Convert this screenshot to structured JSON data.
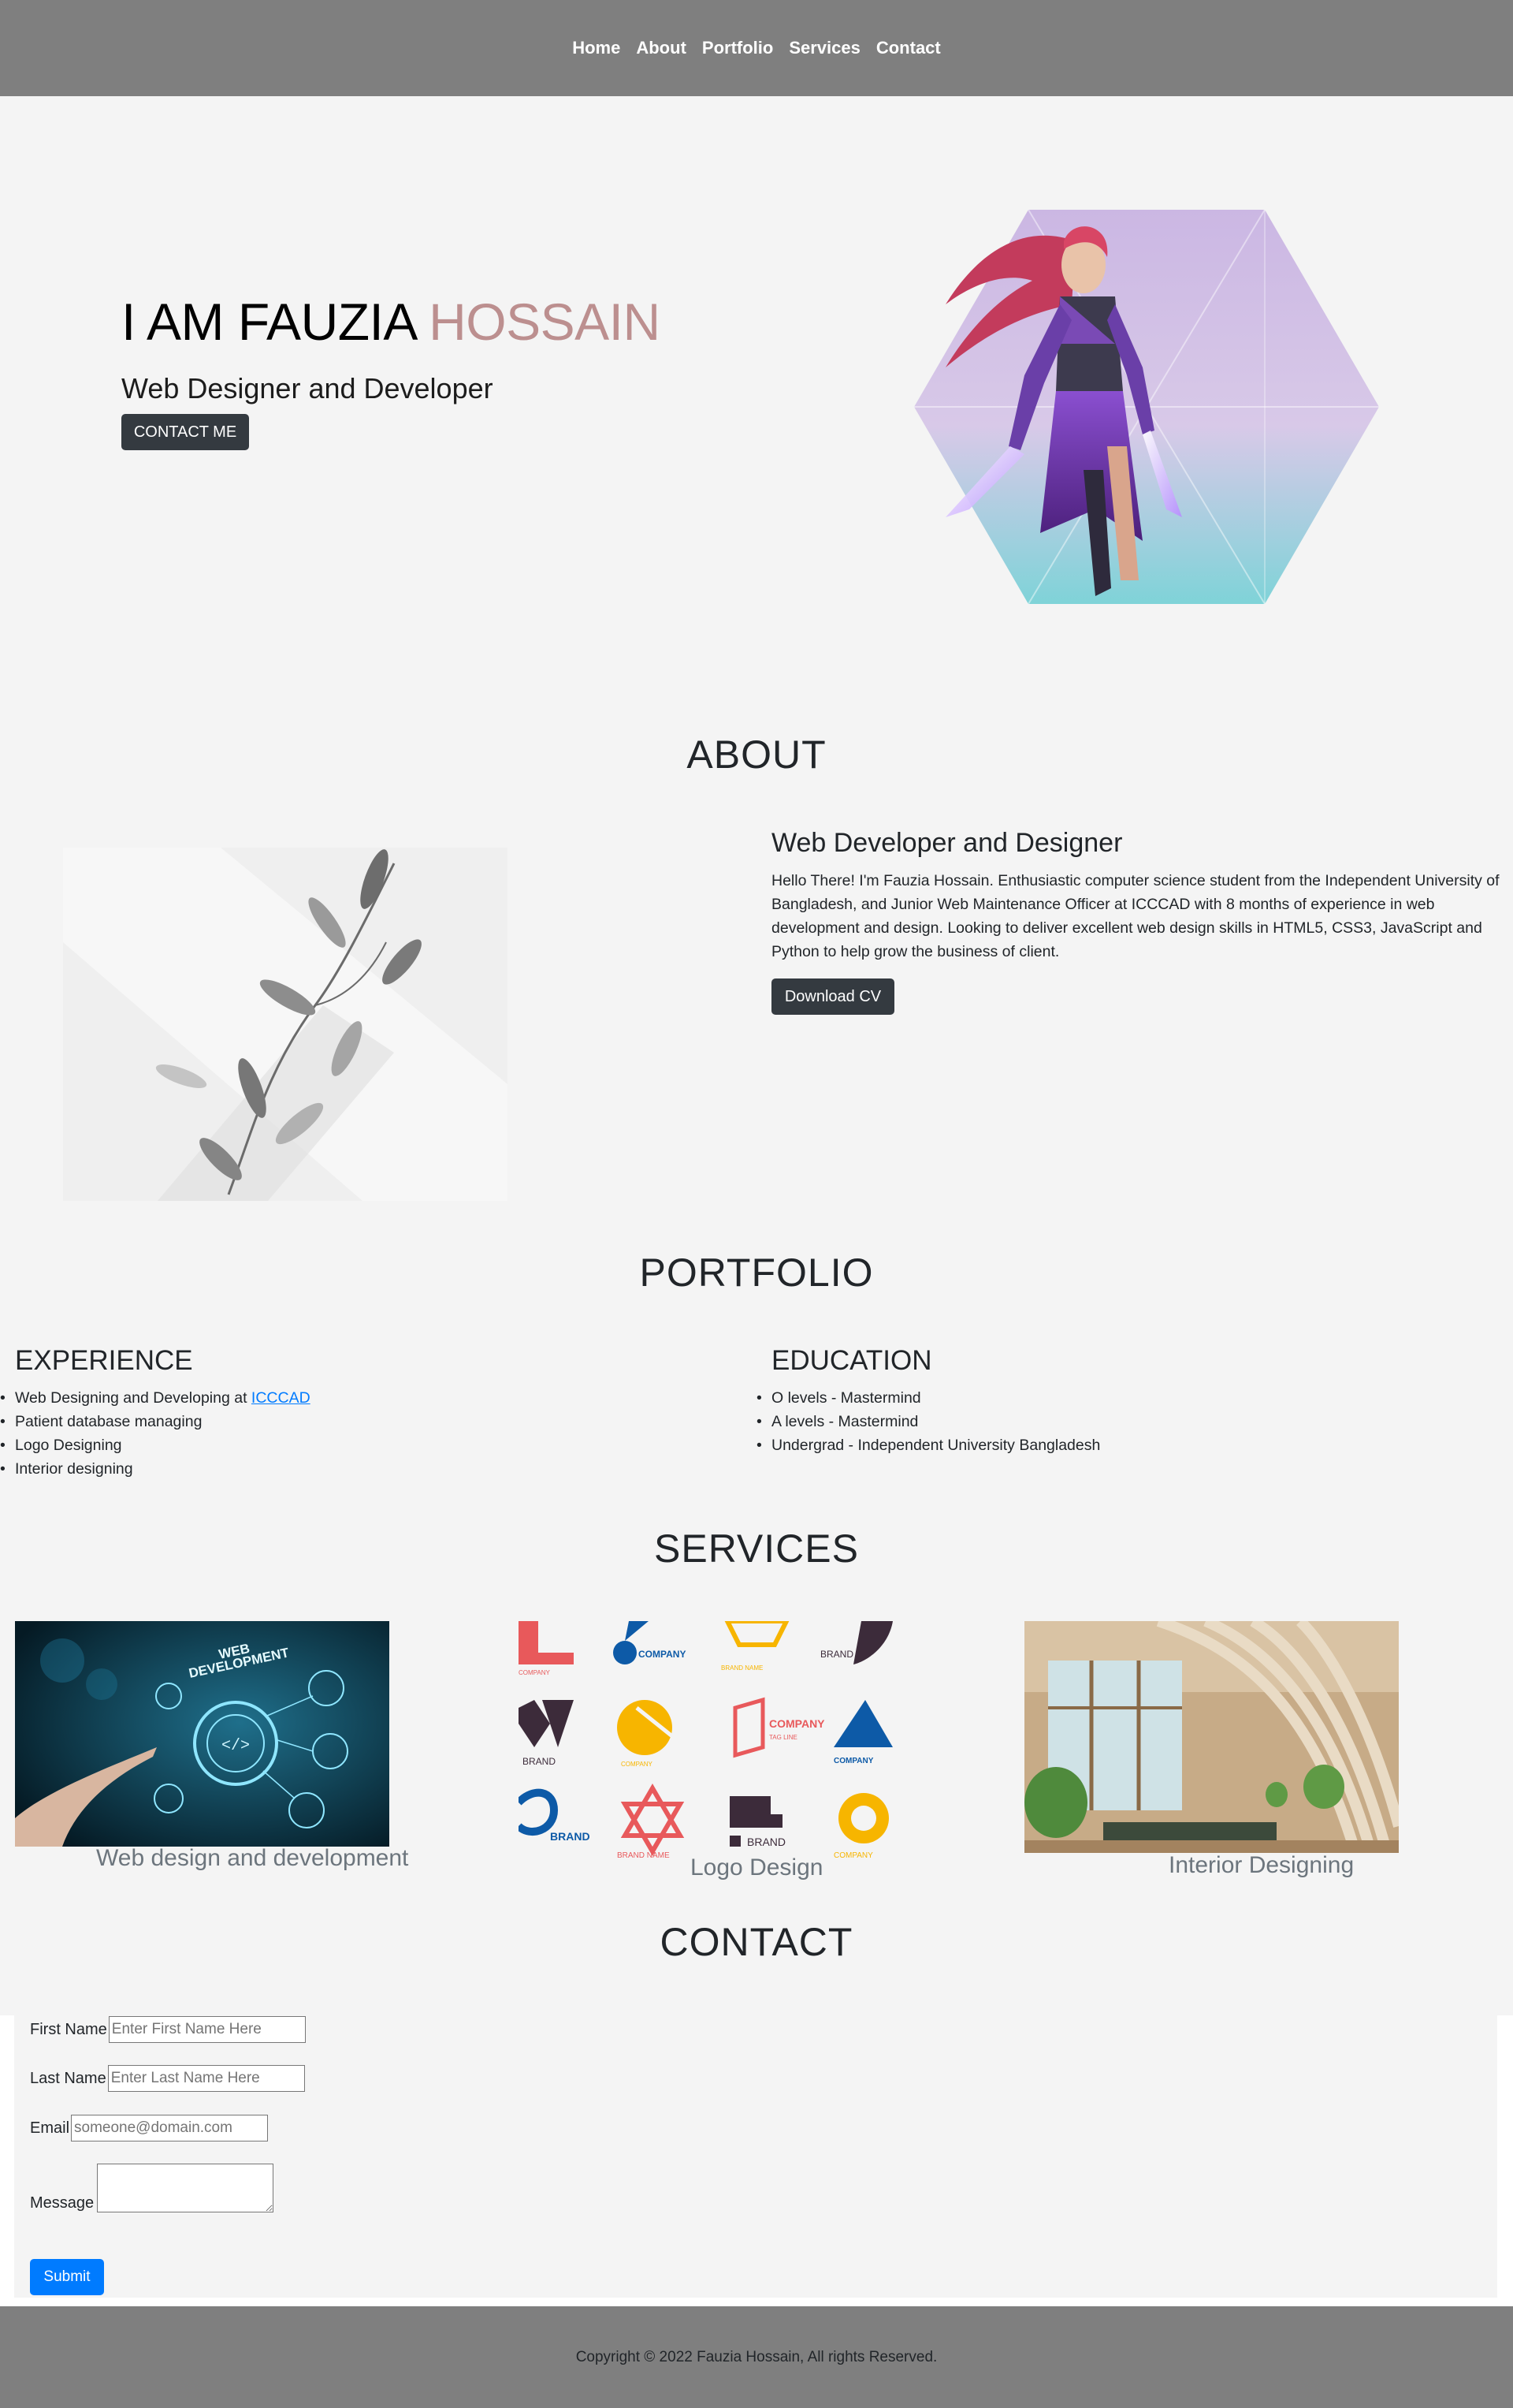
{
  "nav": {
    "items": [
      "Home",
      "About",
      "Portfolio",
      "Services",
      "Contact"
    ]
  },
  "hero": {
    "title_first": "I AM FAUZIA",
    "title_accent": "HOSSAIN",
    "subtitle": "Web Designer and Developer",
    "cta_label": "CONTACT ME",
    "accent_color": "#bc8f8f"
  },
  "about": {
    "section_title": "ABOUT",
    "heading": "Web Developer and Designer",
    "text": "Hello There! I'm Fauzia Hossain. Enthusiastic computer science student from the Independent University of Bangladesh, and Junior Web Maintenance Officer at ICCCAD with 8 months of experience in web development and design. Looking to deliver excellent web design skills in HTML5, CSS3, JavaScript and Python to help grow the business of client.",
    "button_label": "Download CV"
  },
  "portfolio": {
    "section_title": "PORTFOLIO",
    "experience_heading": "EXPERIENCE",
    "experience_first_prefix": "Web Designing and Developing at ",
    "experience_first_link": "ICCCAD",
    "experience": [
      "Patient database managing",
      "Logo Designing",
      "Interior designing"
    ],
    "education_heading": "EDUCATION",
    "education": [
      "O levels - Mastermind",
      "A levels - Mastermind",
      "Undergrad - Independent University Bangladesh"
    ]
  },
  "services": {
    "section_title": "SERVICES",
    "captions": [
      "Web design and development",
      "Logo Design",
      "Interior Designing"
    ],
    "image_texts": {
      "web_line1": "WEB",
      "web_line2": "DEVELOPMENT",
      "company": "COMPANY",
      "brand": "BRAND",
      "brand_name": "BRAND NAME",
      "company_tagline": "TAG LINE"
    }
  },
  "contact": {
    "section_title": "CONTACT",
    "first_name_label": "First Name",
    "first_name_placeholder": "Enter First Name Here",
    "last_name_label": "Last Name",
    "last_name_placeholder": "Enter Last Name Here",
    "email_label": "Email",
    "email_placeholder": "someone@domain.com",
    "message_label": "Message",
    "submit_label": "Submit"
  },
  "footer": {
    "copyright": "Copyright © 2022 Fauzia Hossain, All rights Reserved."
  }
}
